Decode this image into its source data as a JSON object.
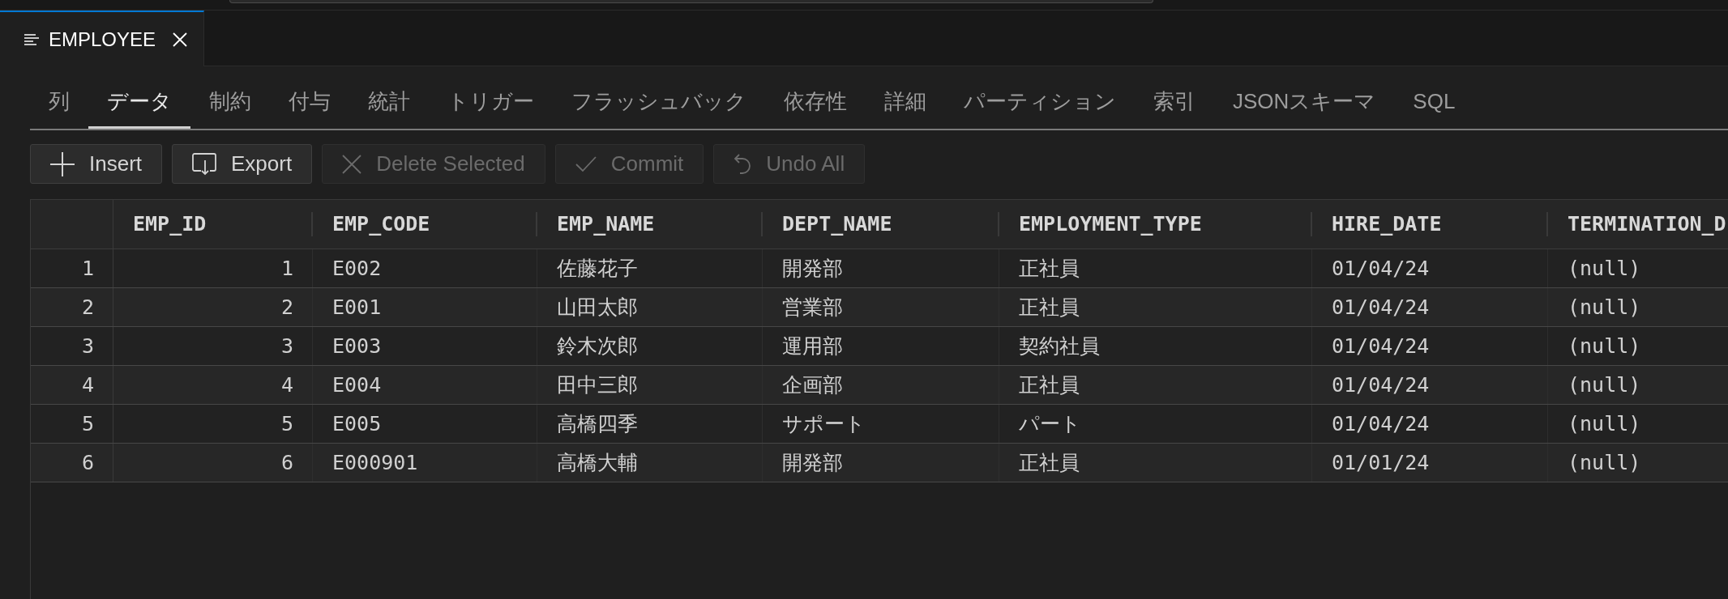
{
  "editor_tabs": [
    {
      "label": "EMPLOYEE",
      "selected": true
    }
  ],
  "view_tabs": [
    {
      "label": "列",
      "selected": false
    },
    {
      "label": "データ",
      "selected": true
    },
    {
      "label": "制約",
      "selected": false
    },
    {
      "label": "付与",
      "selected": false
    },
    {
      "label": "統計",
      "selected": false
    },
    {
      "label": "トリガー",
      "selected": false
    },
    {
      "label": "フラッシュバック",
      "selected": false
    },
    {
      "label": "依存性",
      "selected": false
    },
    {
      "label": "詳細",
      "selected": false
    },
    {
      "label": "パーティション",
      "selected": false
    },
    {
      "label": "索引",
      "selected": false
    },
    {
      "label": "JSONスキーマ",
      "selected": false
    },
    {
      "label": "SQL",
      "selected": false
    }
  ],
  "toolbar": [
    {
      "label": "Insert",
      "disabled": false
    },
    {
      "label": "Export",
      "disabled": false
    },
    {
      "label": "Delete Selected",
      "disabled": true
    },
    {
      "label": "Commit",
      "disabled": true
    },
    {
      "label": "Undo All",
      "disabled": true
    }
  ],
  "table": {
    "columns": [
      {
        "name": "EMP_ID",
        "kind": "number"
      },
      {
        "name": "EMP_CODE",
        "kind": "text"
      },
      {
        "name": "EMP_NAME",
        "kind": "text"
      },
      {
        "name": "DEPT_NAME",
        "kind": "text"
      },
      {
        "name": "EMPLOYMENT_TYPE",
        "kind": "text"
      },
      {
        "name": "HIRE_DATE",
        "kind": "text"
      },
      {
        "name": "TERMINATION_D",
        "kind": "text"
      }
    ],
    "rows": [
      {
        "row_number": "1",
        "cells": [
          "1",
          "E002",
          "佐藤花子",
          "開発部",
          "正社員",
          "01/04/24",
          "(null)"
        ]
      },
      {
        "row_number": "2",
        "cells": [
          "2",
          "E001",
          "山田太郎",
          "営業部",
          "正社員",
          "01/04/24",
          "(null)"
        ]
      },
      {
        "row_number": "3",
        "cells": [
          "3",
          "E003",
          "鈴木次郎",
          "運用部",
          "契約社員",
          "01/04/24",
          "(null)"
        ]
      },
      {
        "row_number": "4",
        "cells": [
          "4",
          "E004",
          "田中三郎",
          "企画部",
          "正社員",
          "01/04/24",
          "(null)"
        ]
      },
      {
        "row_number": "5",
        "cells": [
          "5",
          "E005",
          "高橋四季",
          "サポート",
          "パート",
          "01/04/24",
          "(null)"
        ]
      },
      {
        "row_number": "6",
        "cells": [
          "6",
          "E000901",
          "高橋大輔",
          "開発部",
          "正社員",
          "01/01/24",
          "(null)"
        ]
      }
    ]
  }
}
